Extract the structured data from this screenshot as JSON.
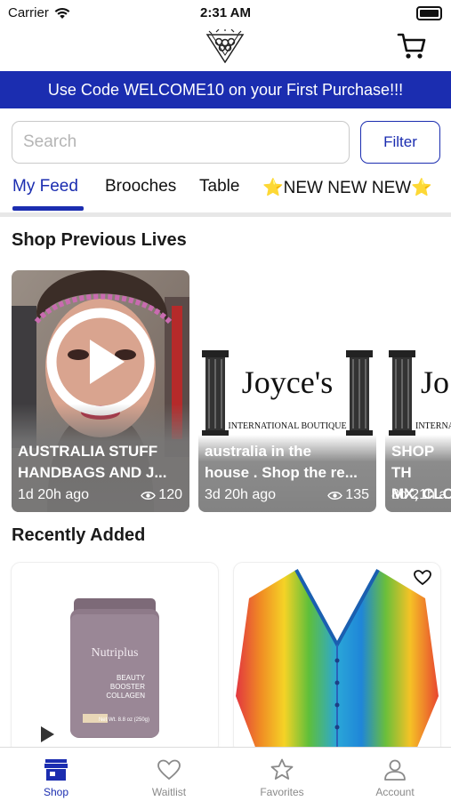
{
  "status_bar": {
    "carrier": "Carrier",
    "time": "2:31 AM"
  },
  "promo": {
    "text": "Use Code WELCOME10 on your First Purchase!!!"
  },
  "search": {
    "placeholder": "Search",
    "value": ""
  },
  "filter": {
    "label": "Filter"
  },
  "tabs": [
    {
      "label": "My Feed",
      "active": true
    },
    {
      "label": "Brooches"
    },
    {
      "label": "Table"
    },
    {
      "label": "⭐NEW NEW NEW⭐"
    }
  ],
  "previous_lives": {
    "title": "Shop Previous Lives",
    "items": [
      {
        "title": "AUSTRALIA STUFF\nHANDBAGS AND J...",
        "time": "1d 20h ago",
        "views": "120"
      },
      {
        "title": "australia in the\nhouse . Shop the re...",
        "time": "3d 20h ago",
        "views": "135",
        "image_text": "Joyce's",
        "image_subtext": "INTERNATIONAL BOUTIQUE"
      },
      {
        "title": "SHOP TH\nMX, CLC",
        "time": "8d 21h a",
        "image_text": "Jo",
        "image_subtext": "INTERNA"
      }
    ]
  },
  "recently_added": {
    "title": "Recently Added",
    "items": [
      {
        "brand": "Nutriplus",
        "label_lines": [
          "BEAUTY",
          "BOOSTER",
          "COLLAGEN"
        ],
        "net_wt": "Net Wt. 8.8 oz (250g)"
      },
      {
        "favorite": false
      }
    ]
  },
  "bottom_nav": [
    {
      "label": "Shop",
      "icon": "shop-icon",
      "active": true
    },
    {
      "label": "Waitlist",
      "icon": "heart-icon"
    },
    {
      "label": "Favorites",
      "icon": "star-icon"
    },
    {
      "label": "Account",
      "icon": "account-icon"
    }
  ],
  "colors": {
    "brand": "#1b2db0",
    "nav_inactive": "#8a8a8a"
  }
}
